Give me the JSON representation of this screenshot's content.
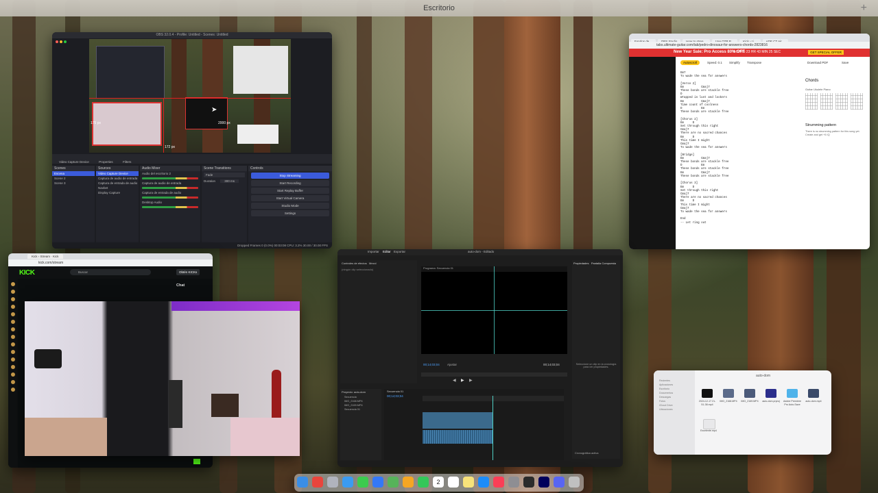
{
  "desktop": {
    "space_label": "Escritorio",
    "add_space": "+"
  },
  "obs": {
    "title": "OBS 32.0.4 - Profile: Untitled - Scenes: Untitled",
    "preview_labels": [
      "175 px",
      "2000 px",
      "172 px"
    ],
    "dock_tabs": [
      "Video Capture Device",
      "Properties",
      "Filters"
    ],
    "scenes": {
      "header": "Scenes",
      "items": [
        "Escena",
        "Scene 2",
        "Scene 3"
      ]
    },
    "sources": {
      "header": "Sources",
      "items": [
        "Video Capture Device",
        "Captura de audio de entrada",
        "Captura de entrada de audio",
        "Navbet",
        "Display Capture"
      ]
    },
    "mixer": {
      "header": "Audio Mixer",
      "channels": [
        "Audio del escritorio 2",
        "Captura de audio de entrada",
        "Captura de entrada de audio",
        "Desktop Audio"
      ]
    },
    "transitions": {
      "header": "Scene Transitions",
      "type": "Fade",
      "duration_label": "Duration",
      "duration": "300 ms"
    },
    "controls": {
      "header": "Controls",
      "buttons": [
        "Stop Streaming",
        "Start Recording",
        "Start Replay Buffer",
        "Start Virtual Camera",
        "Studio Mode",
        "Settings"
      ]
    },
    "status": "Dropped Frames 0 (0.0%)   00:03:08   CPU: 3.2%   30.00 / 30.00 FPS"
  },
  "ug": {
    "tabs": [
      "Fondos de…",
      "OBS Studio",
      "How to strea…",
      "Use OTP P…",
      "Kick › Li…",
      "ADE CT Air…"
    ],
    "url": "tabs.ultimate-guitar.com/tab/pedro-dinosaur-for-answers-chords-2823816",
    "promo_title": "New Year Sale: Pro Access 80% OFF",
    "countdown": "0 DAYS  23 HR  43 MIN  25 SEC",
    "deal": "GET SPECIAL OFFER",
    "autoscroll": "Autoscroll",
    "toolbar_items": [
      "Speed: 0.1",
      "Simplify",
      "Transpose",
      "Download PDF",
      "Save"
    ],
    "lyrics": "Em7\nTo wade the sea for answers\n\n[Verse 2]\nEm          Cmaj7\nThese bonds are stackle free\nD\nWrapped in lust and lookers\nEm          Cmaj7\nTime count of coolness\nD           Em\nThese bonds are stackle free\n\n[Chorus 2]\nEm     D\nSet through this right\nCmaj7\nThere are no sacred chances\nEm     D\nThis time I might\nCmaj7\nTo wade the sea for answers\n\n[Bridge]\nEm          Cmaj7\nThese bonds are stackle free\nD           Em\nThese bonds are stackle free\nEm          Cmaj7\nThese bonds are stackle free\n\n[Chorus 3]\nEm     D\nSet through this right\nCmaj7\nThere are no sacred chances\nEm     D\nThis time I might\nCmaj7\nTo wade the sea for answers\n\nEnd\n-- Let ring out",
    "chords_header": "Chords",
    "chord_tabs": "Guitar   Ukulele   Piano",
    "chord_names": [
      "Em",
      "Cmaj7",
      "D",
      "Em"
    ],
    "strum_header": "Strumming pattern",
    "strum_text": "There is no strumming pattern for this song yet. Create and get +5 IQ"
  },
  "kick": {
    "tab": "Kick › Stream · Kick",
    "url": "kick.com/stream",
    "logo": "KICK",
    "search_placeholder": "Buscar",
    "get_kicks": "Obtén KICKs",
    "chat_header": "Chat",
    "send": "Chat"
  },
  "premiere": {
    "menu": [
      "Importar",
      "Editar",
      "Exportar"
    ],
    "title": "auto-dom - Editado",
    "effects_tabs": [
      "Controles de efectos",
      "Mezcl"
    ],
    "effects_empty": "(ningún clip seleccionado)",
    "monitor_header": "Programa: Secuencia 01",
    "timecode": "00;14;03;04",
    "fit": "Ajustar",
    "end_timecode": "00;14;03;04",
    "props_header": "Propiedades",
    "props_tab2": "Pantalla Compuesta",
    "props_text": "Seleccione un clip en la cronología para ver propiedades.",
    "project_header": "Proyecto: auto-dom",
    "timeline_header": "Secuencia 01",
    "timeline_timecode": "00;14;03;04",
    "project_items": [
      "Secuencia",
      "IMG_2168.MP4",
      "IMG_2169.MP4",
      "Secuencia 01"
    ],
    "footer": "Cronográfica activa"
  },
  "finder": {
    "title": "auto-dom",
    "sidebar": [
      "Recientes",
      "Aplicaciones",
      "Escritorio",
      "Documentos",
      "Descargas",
      "Fotos",
      "iCloud Drive",
      "Ubicaciones"
    ],
    "files": [
      {
        "name": "2024-12-17 21-51-38.mp4",
        "color": "#111111"
      },
      {
        "name": "IMG_2168.MP4",
        "color": "#5b6b8a"
      },
      {
        "name": "IMG_2169.MP4",
        "color": "#4b5a7a"
      },
      {
        "name": "auto-dom.prproj",
        "color": "#2b2e8c"
      },
      {
        "name": "Adobe Premiere Pro Auto-Save",
        "color": "#4fb3ea"
      },
      {
        "name": "auto-dom.mp4",
        "color": "#3a4a6a"
      }
    ],
    "extra_file": "Excelente.mp4"
  },
  "dock": {
    "apps": [
      "finder",
      "chrome",
      "launchpad",
      "safari",
      "messages",
      "mail",
      "maps",
      "photos",
      "facetime",
      "calendar",
      "reminders",
      "notes",
      "app-store",
      "music",
      "system-settings",
      "obs",
      "premiere",
      "discord",
      "trash"
    ],
    "colors": [
      "#3a8ee6",
      "#e8453c",
      "#b0b3bd",
      "#3b9bf0",
      "#3ccb4e",
      "#3478f6",
      "#56b35a",
      "#f5a623",
      "#34c759",
      "#ffffff",
      "#ffffff",
      "#f7e27a",
      "#1d8cf8",
      "#fa3e56",
      "#8e8e93",
      "#2b2b2b",
      "#00005b",
      "#5865f2",
      "#c0c0c0"
    ],
    "calendar_day": "2"
  }
}
